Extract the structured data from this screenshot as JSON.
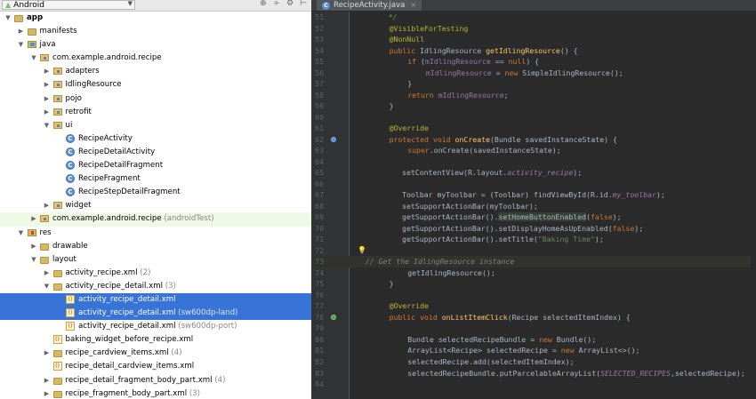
{
  "project_panel": {
    "view_selector": "Android"
  },
  "tree": [
    {
      "indent": 0,
      "twisty": "▼",
      "icon": "folder",
      "label": "app",
      "bold": true
    },
    {
      "indent": 1,
      "twisty": "▶",
      "icon": "folder",
      "label": "manifests"
    },
    {
      "indent": 1,
      "twisty": "▼",
      "icon": "java",
      "label": "java"
    },
    {
      "indent": 2,
      "twisty": "▼",
      "icon": "pkg",
      "label": "com.example.android.recipe"
    },
    {
      "indent": 3,
      "twisty": "▶",
      "icon": "pkg",
      "label": "adapters"
    },
    {
      "indent": 3,
      "twisty": "▶",
      "icon": "pkg",
      "label": "IdlingResource"
    },
    {
      "indent": 3,
      "twisty": "▶",
      "icon": "pkg",
      "label": "pojo"
    },
    {
      "indent": 3,
      "twisty": "▶",
      "icon": "pkg",
      "label": "retrofit"
    },
    {
      "indent": 3,
      "twisty": "▼",
      "icon": "pkg",
      "label": "ui"
    },
    {
      "indent": 4,
      "twisty": "",
      "icon": "cls",
      "label": "RecipeActivity"
    },
    {
      "indent": 4,
      "twisty": "",
      "icon": "cls",
      "label": "RecipeDetailActivity"
    },
    {
      "indent": 4,
      "twisty": "",
      "icon": "cls",
      "label": "RecipeDetailFragment"
    },
    {
      "indent": 4,
      "twisty": "",
      "icon": "cls",
      "label": "RecipeFragment"
    },
    {
      "indent": 4,
      "twisty": "",
      "icon": "cls",
      "label": "RecipeStepDetailFragment"
    },
    {
      "indent": 3,
      "twisty": "▶",
      "icon": "pkg",
      "label": "widget"
    },
    {
      "indent": 2,
      "twisty": "▶",
      "icon": "pkg",
      "label": "com.example.android.recipe",
      "suffix": " (androidTest)",
      "green": true
    },
    {
      "indent": 1,
      "twisty": "▼",
      "icon": "res",
      "label": "res"
    },
    {
      "indent": 2,
      "twisty": "▶",
      "icon": "folder",
      "label": "drawable"
    },
    {
      "indent": 2,
      "twisty": "▼",
      "icon": "folder",
      "label": "layout"
    },
    {
      "indent": 3,
      "twisty": "▶",
      "icon": "folder",
      "label": "activity_recipe.xml",
      "suffix": " (2)"
    },
    {
      "indent": 3,
      "twisty": "▼",
      "icon": "folder",
      "label": "activity_recipe_detail.xml",
      "suffix": " (3)"
    },
    {
      "indent": 4,
      "twisty": "",
      "icon": "xml",
      "label": "activity_recipe_detail.xml",
      "selected": true
    },
    {
      "indent": 4,
      "twisty": "",
      "icon": "xml",
      "label": "activity_recipe_detail.xml",
      "suffix": " (sw600dp-land)",
      "selected": true
    },
    {
      "indent": 4,
      "twisty": "",
      "icon": "xml",
      "label": "activity_recipe_detail.xml",
      "suffix": " (sw600dp-port)"
    },
    {
      "indent": 3,
      "twisty": "",
      "icon": "xml",
      "label": "baking_widget_before_recipe.xml"
    },
    {
      "indent": 3,
      "twisty": "▶",
      "icon": "folder",
      "label": "recipe_cardview_items.xml",
      "suffix": " (4)"
    },
    {
      "indent": 3,
      "twisty": "",
      "icon": "xml",
      "label": "recipe_detail_cardview_items.xml"
    },
    {
      "indent": 3,
      "twisty": "▶",
      "icon": "folder",
      "label": "recipe_detail_fragment_body_part.xml",
      "suffix": " (4)"
    },
    {
      "indent": 3,
      "twisty": "▶",
      "icon": "folder",
      "label": "recipe_fragment_body_part.xml",
      "suffix": " (3)"
    }
  ],
  "editor": {
    "tab_label": "RecipeActivity.java",
    "lines": [
      {
        "n": "51",
        "col": 0,
        "segs": [
          [
            "    */",
            "dc"
          ]
        ]
      },
      {
        "n": "52",
        "col": 1,
        "segs": [
          [
            "@VisibleForTesting",
            "an"
          ]
        ]
      },
      {
        "n": "53",
        "col": 1,
        "segs": [
          [
            "@NonNull",
            "an"
          ]
        ]
      },
      {
        "n": "54",
        "col": 1,
        "segs": [
          [
            "public ",
            "kw"
          ],
          [
            "IdlingResource ",
            ""
          ],
          [
            "getIdlingResource",
            "fn"
          ],
          [
            "() {",
            ""
          ]
        ]
      },
      {
        "n": "55",
        "col": 2,
        "segs": [
          [
            "if ",
            "kw"
          ],
          [
            "(",
            ""
          ],
          [
            "mIdlingResource",
            "fd"
          ],
          [
            " == ",
            ""
          ],
          [
            "null",
            "kw"
          ],
          [
            ") {",
            ""
          ]
        ]
      },
      {
        "n": "56",
        "col": 3,
        "segs": [
          [
            "mIdlingResource",
            "fd"
          ],
          [
            " = ",
            ""
          ],
          [
            "new ",
            "kw"
          ],
          [
            "SimpleIdlingResource();",
            ""
          ]
        ]
      },
      {
        "n": "57",
        "col": 2,
        "segs": [
          [
            "}",
            ""
          ]
        ]
      },
      {
        "n": "58",
        "col": 2,
        "segs": [
          [
            "return ",
            "kw"
          ],
          [
            "mIdlingResource",
            "fd"
          ],
          [
            ";",
            ""
          ]
        ]
      },
      {
        "n": "59",
        "col": 1,
        "segs": [
          [
            "}",
            ""
          ]
        ]
      },
      {
        "n": "60",
        "col": 0,
        "segs": []
      },
      {
        "n": "61",
        "col": 1,
        "segs": [
          [
            "@Override",
            "an"
          ]
        ]
      },
      {
        "n": "62",
        "col": 1,
        "gicon": "ov",
        "segs": [
          [
            "protected void ",
            "kw"
          ],
          [
            "onCreate",
            "fn"
          ],
          [
            "(Bundle savedInstanceState) {",
            ""
          ]
        ]
      },
      {
        "n": "63",
        "col": 2,
        "segs": [
          [
            "super",
            "kw"
          ],
          [
            ".onCreate(savedInstanceState);",
            ""
          ]
        ]
      },
      {
        "n": "64",
        "col": 0,
        "segs": []
      },
      {
        "n": "65",
        "col": 1.7,
        "segs": [
          [
            "setContentView(R.layout.",
            ""
          ],
          [
            "activity_recipe",
            "cst"
          ],
          [
            ");",
            ""
          ]
        ]
      },
      {
        "n": "66",
        "col": 0,
        "segs": []
      },
      {
        "n": "67",
        "col": 1.7,
        "segs": [
          [
            "Toolbar myToolbar = (Toolbar) findViewById(R.id.",
            ""
          ],
          [
            "my_toolbar",
            "cst"
          ],
          [
            ");",
            ""
          ]
        ]
      },
      {
        "n": "68",
        "col": 1.7,
        "segs": [
          [
            "setSupportActionBar(myToolbar);",
            ""
          ]
        ]
      },
      {
        "n": "69",
        "col": 1.7,
        "segs": [
          [
            "getSupportActionBar().",
            ""
          ],
          [
            "setHomeButtonEnabled",
            "sh"
          ],
          [
            "(",
            ""
          ],
          [
            "false",
            "kw"
          ],
          [
            ");",
            ""
          ]
        ]
      },
      {
        "n": "70",
        "col": 1.7,
        "segs": [
          [
            "getSupportActionBar().setDisplayHomeAsUpEnabled(",
            ""
          ],
          [
            "false",
            "kw"
          ],
          [
            ");",
            ""
          ]
        ]
      },
      {
        "n": "71",
        "col": 1.7,
        "segs": [
          [
            "getSupportActionBar().setTitle(",
            ""
          ],
          [
            "\"Baking Time\"",
            "st"
          ],
          [
            ");",
            ""
          ]
        ]
      },
      {
        "n": "72",
        "col": 0,
        "bulb": true,
        "segs": []
      },
      {
        "n": "73",
        "col": -0.3,
        "hl": true,
        "segs": [
          [
            "// Get the IdlingResource instance",
            "cmi"
          ]
        ]
      },
      {
        "n": "74",
        "col": 2,
        "segs": [
          [
            "getIdlingResource();",
            ""
          ]
        ]
      },
      {
        "n": "75",
        "col": 1,
        "segs": [
          [
            "}",
            ""
          ]
        ]
      },
      {
        "n": "76",
        "col": 0,
        "segs": []
      },
      {
        "n": "77",
        "col": 1,
        "segs": [
          [
            "@Override",
            "an"
          ]
        ]
      },
      {
        "n": "78",
        "col": 1,
        "gicon": "im",
        "segs": [
          [
            "public void ",
            "kw"
          ],
          [
            "onListItemClick",
            "fn"
          ],
          [
            "(Recipe selectedItemIndex) {",
            ""
          ]
        ]
      },
      {
        "n": "79",
        "col": 0,
        "segs": []
      },
      {
        "n": "80",
        "col": 2,
        "segs": [
          [
            "Bundle selectedRecipeBundle = ",
            ""
          ],
          [
            "new ",
            "kw"
          ],
          [
            "Bundle();",
            ""
          ]
        ]
      },
      {
        "n": "81",
        "col": 2,
        "segs": [
          [
            "ArrayList<Recipe> selectedRecipe = ",
            ""
          ],
          [
            "new ",
            "kw"
          ],
          [
            "ArrayList<>();",
            ""
          ]
        ]
      },
      {
        "n": "82",
        "col": 2,
        "segs": [
          [
            "selectedRecipe.add(selectedItemIndex);",
            ""
          ]
        ]
      },
      {
        "n": "83",
        "col": 2,
        "segs": [
          [
            "selectedRecipeBundle.putParcelableArrayList(",
            ""
          ],
          [
            "SELECTED_RECIPES",
            "cst"
          ],
          [
            ",selectedRecipe);",
            ""
          ]
        ]
      },
      {
        "n": "84",
        "col": 0,
        "segs": []
      }
    ]
  },
  "colors": {
    "selection": "#3874d8",
    "editor_bg": "#2b2b2b",
    "keyword": "#cc7832",
    "annotation": "#bbb529",
    "method": "#ffc66d",
    "string": "#6a8759",
    "field": "#9876aa"
  }
}
